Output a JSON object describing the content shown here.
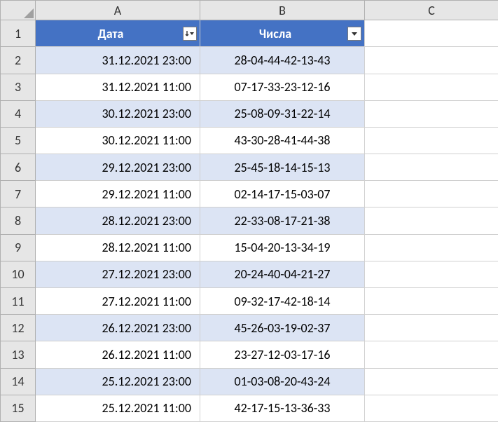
{
  "columns": [
    "A",
    "B",
    "C"
  ],
  "row_numbers": [
    1,
    2,
    3,
    4,
    5,
    6,
    7,
    8,
    9,
    10,
    11,
    12,
    13,
    14,
    15
  ],
  "header": {
    "date_label": "Дата",
    "nums_label": "Числа"
  },
  "rows": [
    {
      "date": "31.12.2021 23:00",
      "nums": "28-04-44-42-13-43"
    },
    {
      "date": "31.12.2021 11:00",
      "nums": "07-17-33-23-12-16"
    },
    {
      "date": "30.12.2021 23:00",
      "nums": "25-08-09-31-22-14"
    },
    {
      "date": "30.12.2021 11:00",
      "nums": "43-30-28-41-44-38"
    },
    {
      "date": "29.12.2021 23:00",
      "nums": "25-45-18-14-15-13"
    },
    {
      "date": "29.12.2021 11:00",
      "nums": "02-14-17-15-03-07"
    },
    {
      "date": "28.12.2021 23:00",
      "nums": "22-33-08-17-21-38"
    },
    {
      "date": "28.12.2021 11:00",
      "nums": "15-04-20-13-34-19"
    },
    {
      "date": "27.12.2021 23:00",
      "nums": "20-24-40-04-21-27"
    },
    {
      "date": "27.12.2021 11:00",
      "nums": "09-32-17-42-18-14"
    },
    {
      "date": "26.12.2021 23:00",
      "nums": "45-26-03-19-02-37"
    },
    {
      "date": "26.12.2021 11:00",
      "nums": "23-27-12-03-17-16"
    },
    {
      "date": "25.12.2021 23:00",
      "nums": "01-03-08-20-43-24"
    },
    {
      "date": "25.12.2021 11:00",
      "nums": "42-17-15-13-36-33"
    }
  ]
}
